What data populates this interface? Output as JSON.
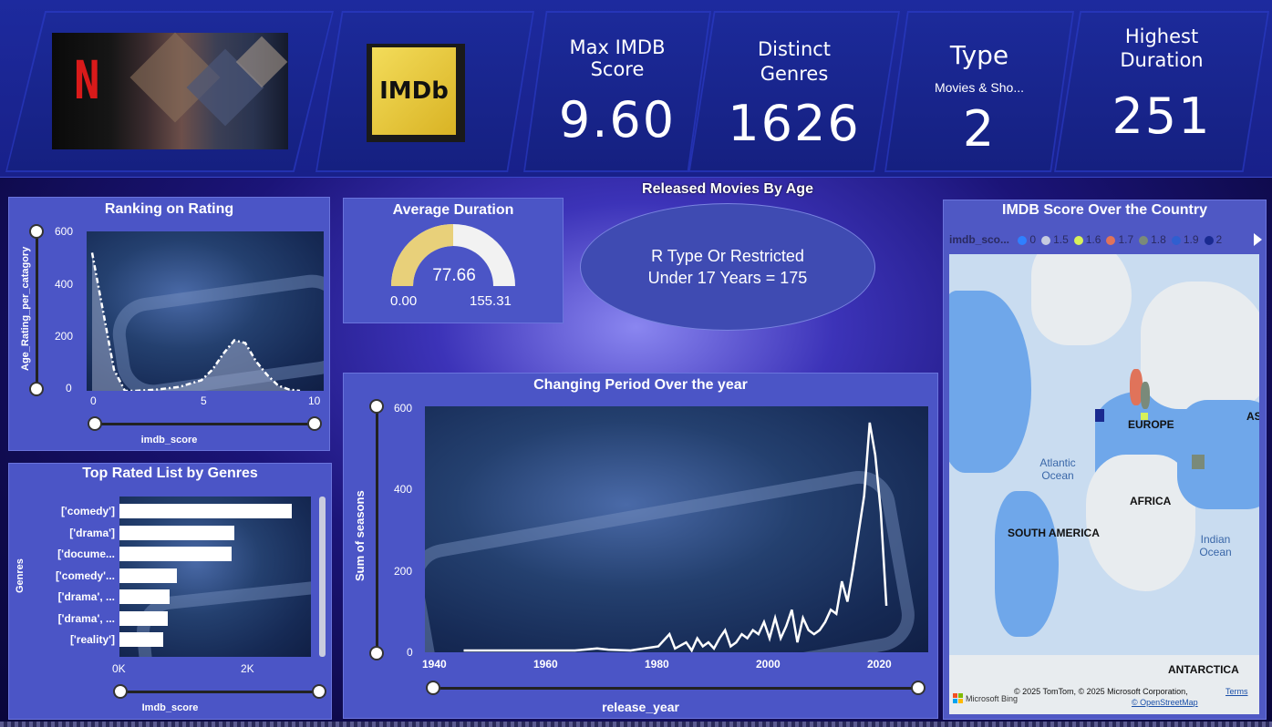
{
  "kpis": {
    "max_imdb": {
      "title_l1": "Max IMDB",
      "title_l2": "Score",
      "value": "9.60"
    },
    "distinct_genres": {
      "title_l1": "Distinct",
      "title_l2": "Genres",
      "value": "1626"
    },
    "type": {
      "title": "Type",
      "subtitle": "Movies & Sho...",
      "value": "2"
    },
    "highest_duration": {
      "title_l1": "Highest",
      "title_l2": "Duration",
      "value": "251"
    }
  },
  "logos": {
    "netflix_letter": "N",
    "imdb": "IMDb"
  },
  "ranking": {
    "title": "Ranking on Rating",
    "ylabel": "Age_Rating_per_catagory",
    "xlabel": "imdb_score",
    "yticks": [
      "600",
      "400",
      "200",
      "0"
    ],
    "xticks": [
      "0",
      "5",
      "10"
    ]
  },
  "avg_duration": {
    "title": "Average Duration",
    "value": "77.66",
    "min": "0.00",
    "max": "155.31",
    "fill_fraction": 0.5
  },
  "released_by_age": {
    "title": "Released Movies By Age",
    "line1": "R Type Or Restricted",
    "line2": "Under 17 Years = 175"
  },
  "genres": {
    "title": "Top Rated List by Genres",
    "ylabel": "Genres",
    "xlabel": "Imdb_score",
    "xticks": [
      "0K",
      "2K"
    ]
  },
  "changing": {
    "title": "Changing Period Over the year",
    "ylabel": "Sum of seasons",
    "xlabel": "release_year",
    "yticks": [
      "600",
      "400",
      "200",
      "0"
    ],
    "xticks": [
      "1940",
      "1960",
      "1980",
      "2000",
      "2020"
    ]
  },
  "map": {
    "title": "IMDB Score Over the Country",
    "legend_title": "imdb_sco...",
    "legend": [
      {
        "label": "0",
        "color": "#2f80ff"
      },
      {
        "label": "1.5",
        "color": "#c5cbe0"
      },
      {
        "label": "1.6",
        "color": "#d7f05a"
      },
      {
        "label": "1.7",
        "color": "#e0735a"
      },
      {
        "label": "1.8",
        "color": "#7a8a7a"
      },
      {
        "label": "1.9",
        "color": "#2f5fd0"
      },
      {
        "label": "2",
        "color": "#1a2a90"
      }
    ],
    "labels": {
      "europe": "EUROPE",
      "africa": "AFRICA",
      "south_america": "SOUTH AMERICA",
      "antarctica": "ANTARCTICA",
      "asia": "AS",
      "atlantic": "Atlantic\nOcean",
      "indian": "Indian\nOcean"
    },
    "bing": "Microsoft Bing",
    "copyright": "© 2025 TomTom, © 2025 Microsoft Corporation,",
    "terms": "Terms",
    "osm": "© OpenStreetMap"
  },
  "chart_data": [
    {
      "type": "area",
      "title": "Ranking on Rating",
      "xlabel": "imdb_score",
      "ylabel": "Age_Rating_per_catagory",
      "xlim": [
        0,
        10
      ],
      "ylim": [
        0,
        600
      ],
      "x": [
        0,
        0.5,
        1,
        1.5,
        2,
        3,
        4,
        5,
        5.5,
        6,
        6.5,
        7,
        7.5,
        8,
        8.5,
        9,
        9.5
      ],
      "values": [
        520,
        300,
        80,
        0,
        0,
        5,
        15,
        40,
        80,
        140,
        190,
        180,
        110,
        60,
        20,
        5,
        0
      ]
    },
    {
      "type": "bar",
      "title": "Top Rated List by Genres",
      "xlabel": "Imdb_score",
      "ylabel": "Genres",
      "categories": [
        "['comedy']",
        "['drama']",
        "['docume...",
        "['comedy'...",
        "['drama', ...",
        "['drama', ...",
        "['reality']"
      ],
      "values": [
        2700,
        1800,
        1750,
        900,
        780,
        750,
        680
      ],
      "xlim": [
        0,
        3000
      ]
    },
    {
      "type": "line",
      "title": "Changing Period Over the year",
      "xlabel": "release_year",
      "ylabel": "Sum of seasons",
      "xlim": [
        1940,
        2020
      ],
      "ylim": [
        0,
        600
      ],
      "x": [
        1945,
        1955,
        1965,
        1969,
        1971,
        1975,
        1980,
        1982,
        1983,
        1985,
        1986,
        1987,
        1988,
        1989,
        1990,
        1991,
        1992,
        1993,
        1994,
        1995,
        1996,
        1997,
        1998,
        1999,
        2000,
        2001,
        2002,
        2003,
        2004,
        2005,
        2006,
        2007,
        2008,
        2009,
        2010,
        2011,
        2012,
        2013,
        2014,
        2015,
        2016,
        2017,
        2018,
        2019,
        2020,
        2021
      ],
      "values": [
        0,
        0,
        0,
        5,
        2,
        0,
        10,
        40,
        5,
        20,
        0,
        30,
        10,
        20,
        5,
        30,
        50,
        10,
        20,
        40,
        30,
        50,
        40,
        70,
        30,
        80,
        30,
        60,
        100,
        20,
        80,
        50,
        40,
        50,
        70,
        100,
        90,
        170,
        120,
        200,
        290,
        380,
        560,
        480,
        340,
        110
      ]
    }
  ]
}
